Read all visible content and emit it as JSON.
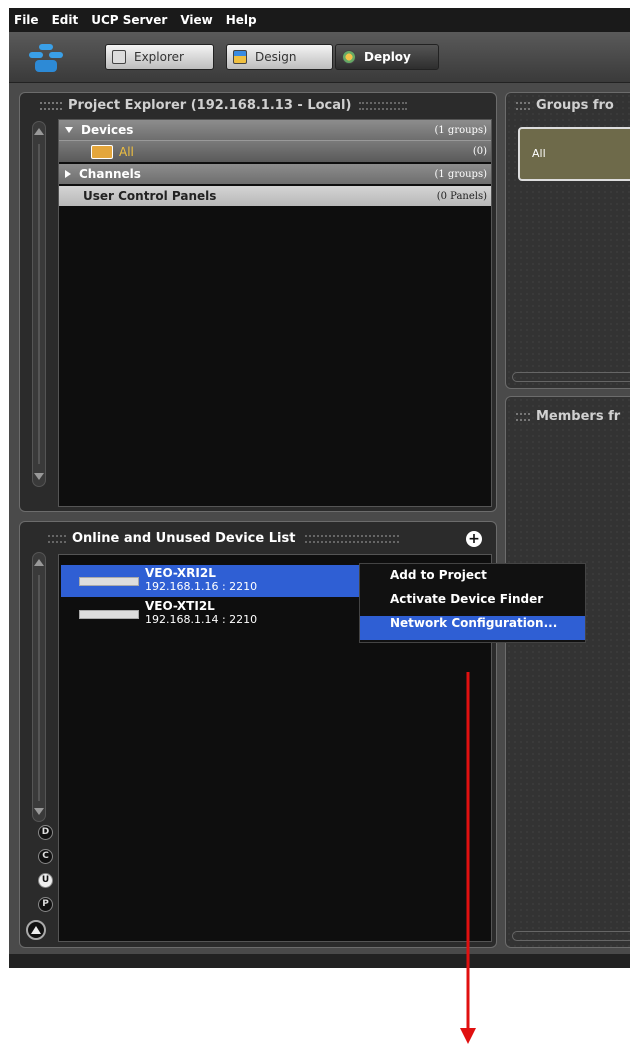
{
  "menu": [
    "File",
    "Edit",
    "UCP Server",
    "View",
    "Help"
  ],
  "toolbar": {
    "explorer": "Explorer",
    "design": "Design",
    "deploy": "Deploy"
  },
  "project_explorer": {
    "title": "Project Explorer (192.168.1.13 - Local)",
    "rows": [
      {
        "label": "Devices",
        "count": "(1 groups)"
      },
      {
        "label": "All",
        "count": "(0)"
      },
      {
        "label": "Channels",
        "count": "(1 groups)"
      },
      {
        "label": "User Control Panels",
        "count": "(0 Panels)"
      }
    ]
  },
  "groups_panel": {
    "title": "Groups fro",
    "item": "All"
  },
  "members_panel": {
    "title": "Members fr"
  },
  "device_list": {
    "title": "Online and Unused Device List",
    "devices": [
      {
        "name": "VEO-XRI2L",
        "ip": "192.168.1.16 : 2210"
      },
      {
        "name": "VEO-XTI2L",
        "ip": "192.168.1.14 : 2210"
      }
    ]
  },
  "context_menu": [
    "Add to Project",
    "Activate Device Finder",
    "Network Configuration..."
  ],
  "mode_buttons": [
    "D",
    "C",
    "U",
    "P"
  ],
  "colors": {
    "selection": "#2f5fd4",
    "annotation_arrow": "#e01010",
    "group_tile": "#6e6a4a"
  }
}
